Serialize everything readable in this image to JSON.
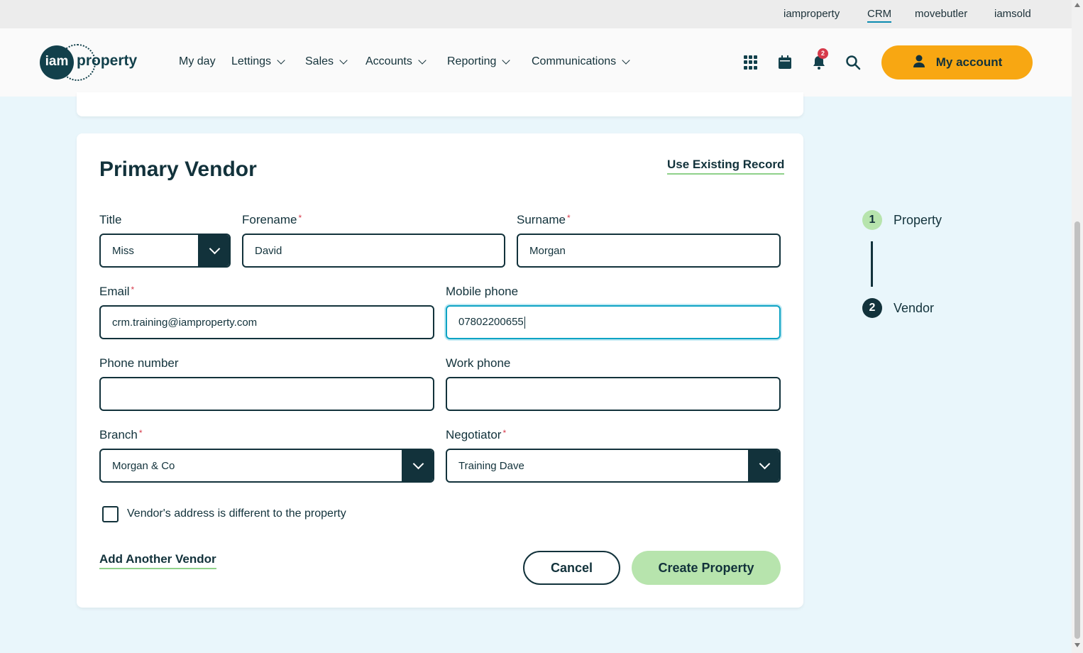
{
  "topbar": {
    "links": [
      "iamproperty",
      "CRM",
      "movebutler",
      "iamsold"
    ],
    "active": "CRM"
  },
  "header": {
    "logo": {
      "mark": "iam",
      "word": "property"
    },
    "nav": [
      "My day",
      "Lettings",
      "Sales",
      "Accounts",
      "Reporting",
      "Communications"
    ],
    "notification_count": "2",
    "account_label": "My account",
    "icons": [
      "apps-grid-icon",
      "calendar-icon",
      "bell-icon",
      "search-icon",
      "user-icon"
    ]
  },
  "form": {
    "title": "Primary Vendor",
    "use_existing": "Use Existing Record",
    "title_label": "Title",
    "title_value": "Miss",
    "forename_label": "Forename",
    "forename_value": "David",
    "surname_label": "Surname",
    "surname_value": "Morgan",
    "email_label": "Email",
    "email_value": "crm.training@iamproperty.com",
    "mobile_label": "Mobile phone",
    "mobile_value": "07802200655",
    "phone_label": "Phone number",
    "phone_value": "",
    "work_label": "Work phone",
    "work_value": "",
    "branch_label": "Branch",
    "branch_value": "Morgan & Co",
    "negotiator_label": "Negotiator",
    "negotiator_value": "Training Dave",
    "required_mark": "*",
    "address_checkbox_label": "Vendor's address is different to the property",
    "address_checked": false,
    "add_vendor": "Add Another Vendor",
    "cancel": "Cancel",
    "create": "Create Property"
  },
  "steps": [
    {
      "num": "1",
      "label": "Property",
      "state": "complete"
    },
    {
      "num": "2",
      "label": "Vendor",
      "state": "current"
    }
  ],
  "colors": {
    "brand_dark": "#12323b",
    "accent_orange": "#f8a712",
    "accent_green": "#b7e4ad",
    "focus_blue": "#0ea3c4",
    "required_red": "#d63a4a",
    "page_bg": "#e9f6fb"
  }
}
